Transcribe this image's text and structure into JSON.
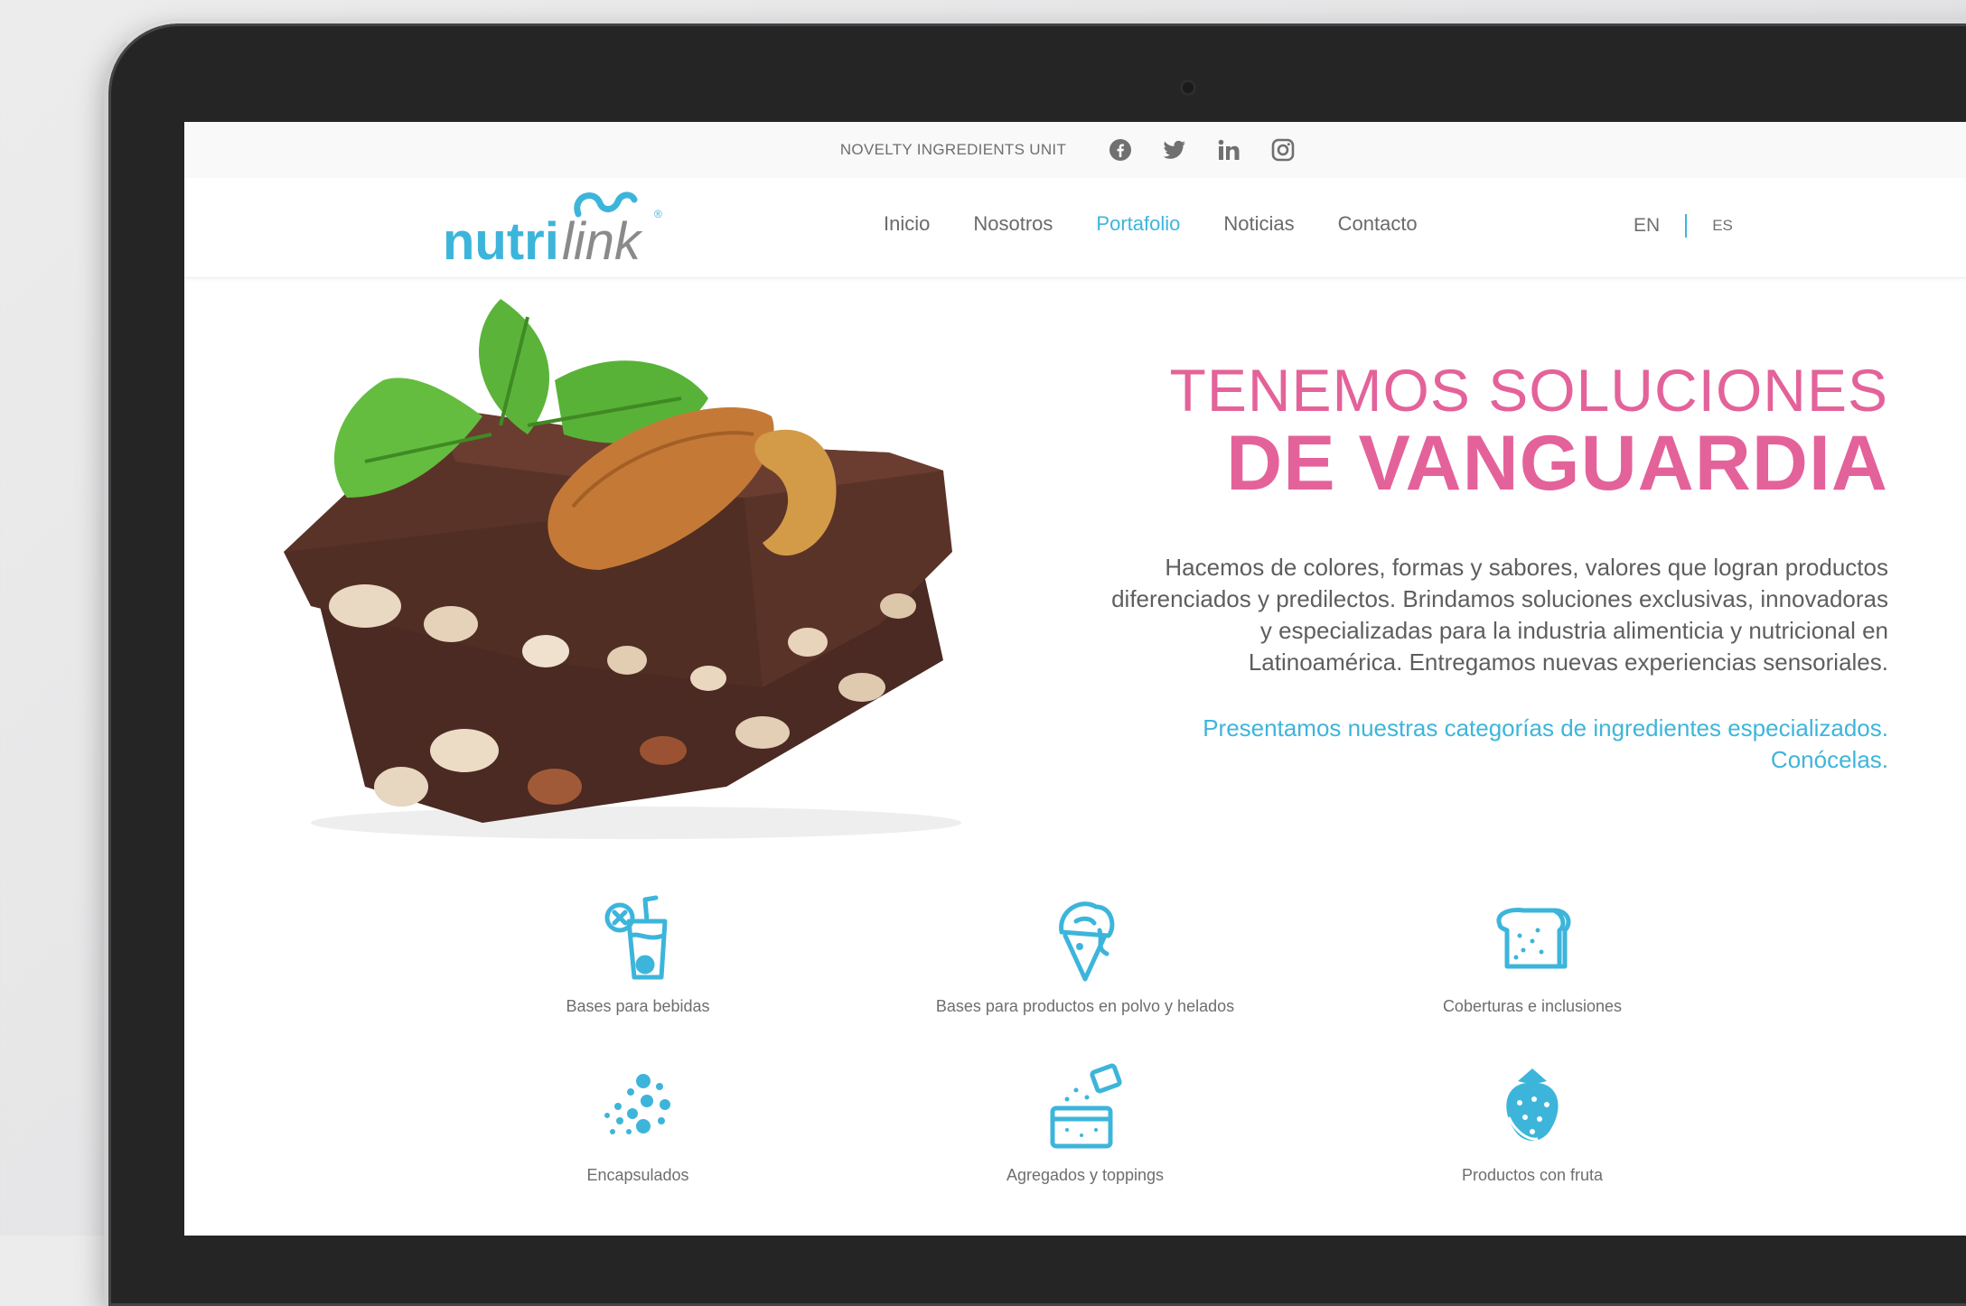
{
  "topbar": {
    "tagline": "NOVELTY INGREDIENTS UNIT",
    "social": [
      "facebook-icon",
      "twitter-icon",
      "linkedin-icon",
      "instagram-icon"
    ]
  },
  "brand": {
    "part1": "nutri",
    "part2": "link",
    "mark": "®",
    "color_primary": "#3db5db",
    "color_secondary": "#8a8a8a"
  },
  "nav": {
    "items": [
      {
        "label": "Inicio"
      },
      {
        "label": "Nosotros"
      },
      {
        "label": "Portafolio"
      },
      {
        "label": "Noticias"
      },
      {
        "label": "Contacto"
      }
    ],
    "active": "Portafolio"
  },
  "lang": {
    "en": "EN",
    "es": "ES"
  },
  "hero": {
    "title_line1": "TENEMOS SOLUCIONES",
    "title_line2": "DE VANGUARDIA",
    "paragraph": "Hacemos de colores, formas y sabores, valores que logran productos diferenciados y predilectos. Brindamos soluciones exclusivas, innovadoras y especializadas para la industria alimenticia y nutricional en Latinoamérica. Entregamos nuevas experiencias sensoriales.",
    "cta_line1": "Presentamos nuestras categorías de ingredientes especializados.",
    "cta_line2": "Conócelas.",
    "accent_color": "#e4629a"
  },
  "categories": [
    {
      "label": "Bases para bebidas",
      "icon": "drink-icon"
    },
    {
      "label": "Bases para productos en polvo y helados",
      "icon": "ice-cream-icon"
    },
    {
      "label": "Coberturas e inclusiones",
      "icon": "bread-icon"
    },
    {
      "label": "Encapsulados",
      "icon": "capsules-icon"
    },
    {
      "label": "Agregados y toppings",
      "icon": "toppings-icon"
    },
    {
      "label": "Productos con fruta",
      "icon": "strawberry-icon"
    }
  ]
}
